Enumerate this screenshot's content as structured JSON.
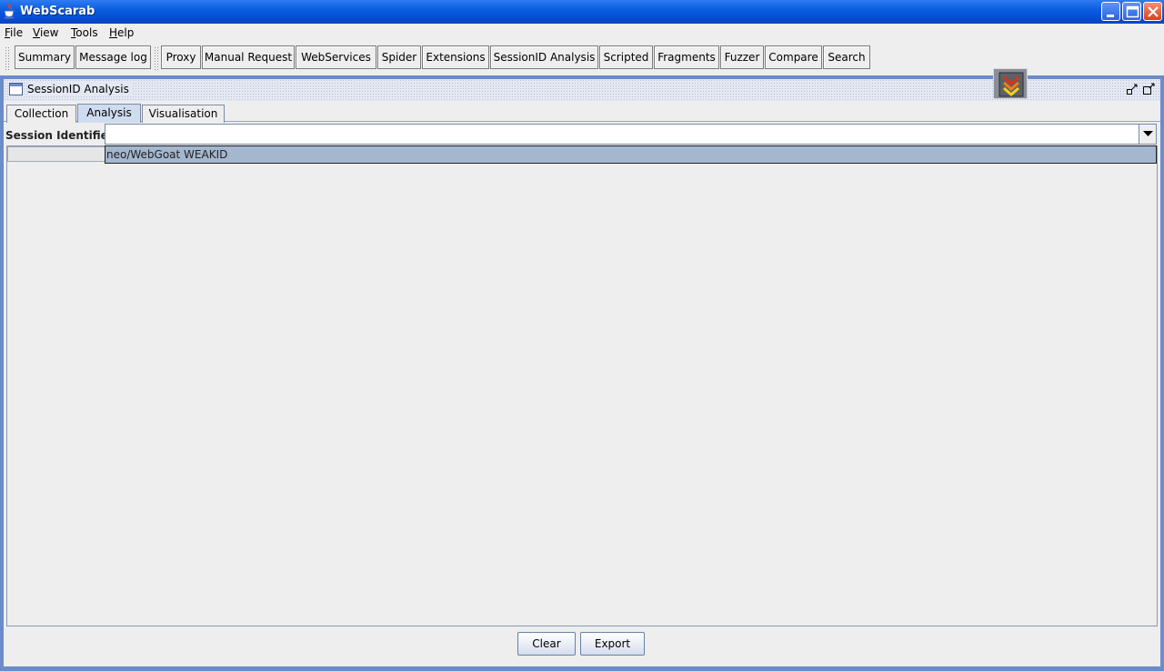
{
  "window": {
    "title": "WebScarab",
    "controls": [
      "minimize",
      "maximize",
      "close"
    ]
  },
  "menu": [
    {
      "mnemonic": "F",
      "rest": "ile"
    },
    {
      "mnemonic": "V",
      "rest": "iew"
    },
    {
      "mnemonic": "T",
      "rest": "ools"
    },
    {
      "mnemonic": "H",
      "rest": "elp"
    }
  ],
  "toolbar": {
    "group1": [
      "Summary",
      "Message log"
    ],
    "group2": [
      "Proxy",
      "Manual Request",
      "WebServices",
      "Spider",
      "Extensions",
      "SessionID Analysis",
      "Scripted",
      "Fragments",
      "Fuzzer",
      "Compare",
      "Search"
    ]
  },
  "frame": {
    "title": "SessionID Analysis",
    "tabs": [
      "Collection",
      "Analysis",
      "Visualisation"
    ],
    "active_tab": "Analysis",
    "session_identifier_label": "Session Identifier :",
    "session_identifier_value": "",
    "dropdown_options": [
      "neo/WebGoat WEAKID"
    ],
    "buttons": {
      "clear": "Clear",
      "export": "Export"
    }
  },
  "colors": {
    "titlebar": "#0a5ee0",
    "frame_border": "#6b8cc9",
    "selection": "#a5b7cf",
    "active_tab": "#cfdcf0"
  }
}
